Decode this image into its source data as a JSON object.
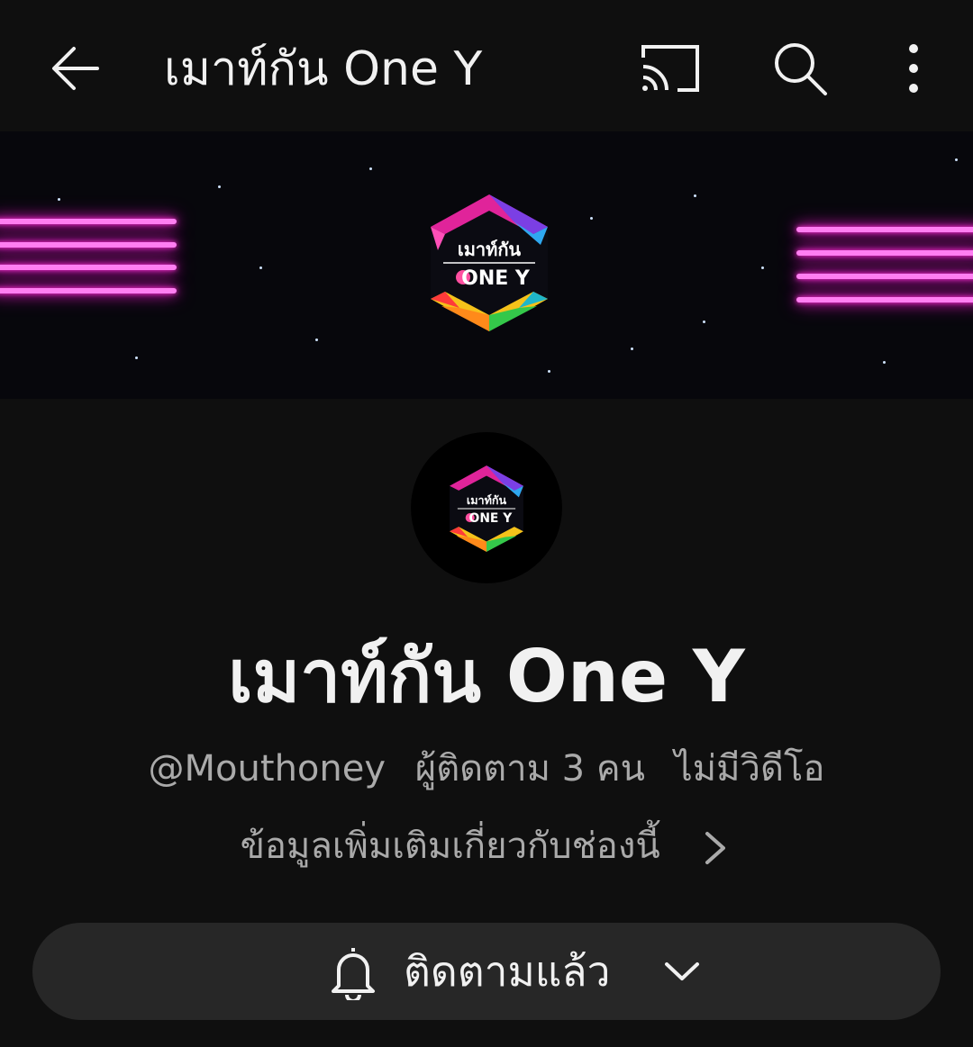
{
  "appbar": {
    "title": "เมาท์กัน One Y",
    "icons": [
      "back-arrow-icon",
      "cast-icon",
      "search-icon",
      "more-vert-icon"
    ]
  },
  "banner": {
    "logo_text_top": "เมาท์กัน",
    "logo_text_bottom": "ONE Y"
  },
  "channel": {
    "name": "เมาท์กัน One Y",
    "handle": "@Mouthoney",
    "subscribers": "ผู้ติดตาม 3 คน",
    "videos": "ไม่มีวิดีโอ",
    "more_info": "ข้อมูลเพิ่มเติมเกี่ยวกับช่องนี้"
  },
  "subscribe_button": {
    "label": "ติดตามแล้ว",
    "icon": "bell-icon"
  },
  "colors": {
    "background": "#0f0f0f",
    "button": "#272727",
    "secondary_text": "#aaaaaa",
    "neon": "#ff7ff2"
  }
}
